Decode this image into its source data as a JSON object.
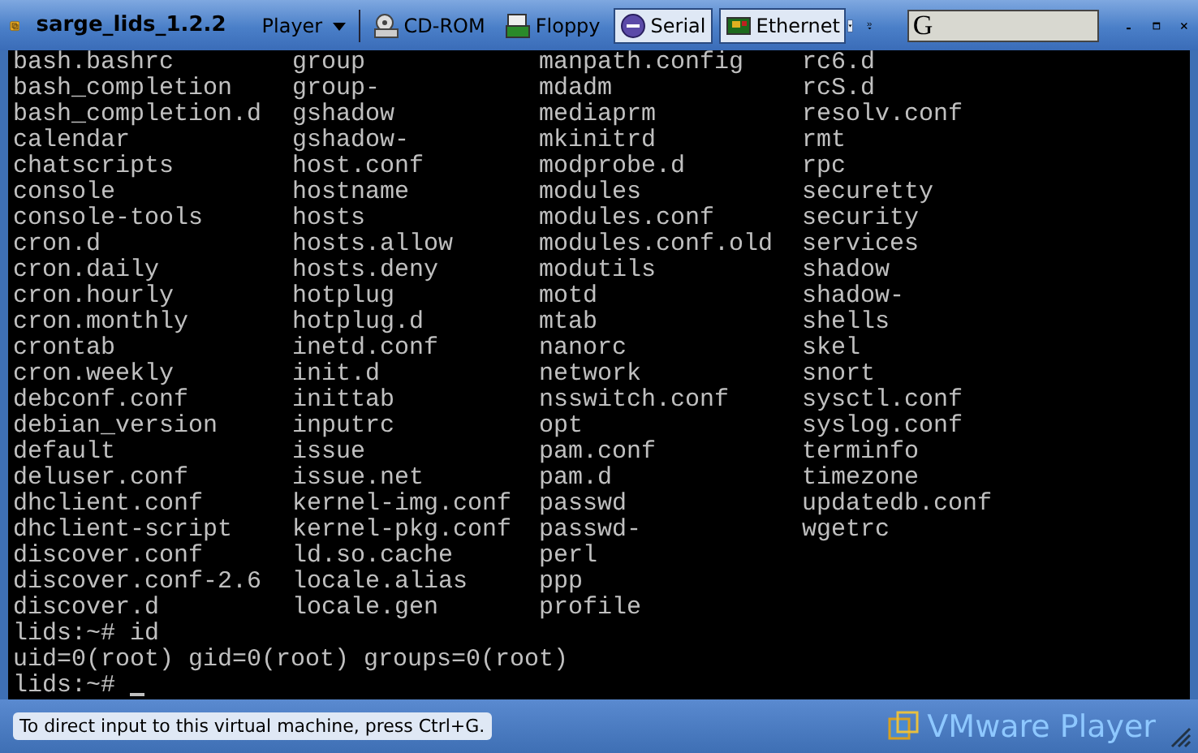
{
  "window": {
    "title": "sarge_lids_1.2.2"
  },
  "toolbar": [
    {
      "kind": "menu",
      "label": "Player"
    },
    {
      "kind": "device",
      "label": "CD-ROM",
      "selected": false
    },
    {
      "kind": "device",
      "label": "Floppy",
      "selected": false
    },
    {
      "kind": "device",
      "label": "Serial",
      "selected": true
    },
    {
      "kind": "device",
      "label": "Ethernet",
      "selected": true
    }
  ],
  "search": {
    "value": "G"
  },
  "terminal": {
    "columns": [
      [
        "bash.bashrc",
        "bash_completion",
        "bash_completion.d",
        "calendar",
        "chatscripts",
        "console",
        "console-tools",
        "cron.d",
        "cron.daily",
        "cron.hourly",
        "cron.monthly",
        "crontab",
        "cron.weekly",
        "debconf.conf",
        "debian_version",
        "default",
        "deluser.conf",
        "dhclient.conf",
        "dhclient-script",
        "discover.conf",
        "discover.conf-2.6",
        "discover.d"
      ],
      [
        "group",
        "group-",
        "gshadow",
        "gshadow-",
        "host.conf",
        "hostname",
        "hosts",
        "hosts.allow",
        "hosts.deny",
        "hotplug",
        "hotplug.d",
        "inetd.conf",
        "init.d",
        "inittab",
        "inputrc",
        "issue",
        "issue.net",
        "kernel-img.conf",
        "kernel-pkg.conf",
        "ld.so.cache",
        "locale.alias",
        "locale.gen"
      ],
      [
        "manpath.config",
        "mdadm",
        "mediaprm",
        "mkinitrd",
        "modprobe.d",
        "modules",
        "modules.conf",
        "modules.conf.old",
        "modutils",
        "motd",
        "mtab",
        "nanorc",
        "network",
        "nsswitch.conf",
        "opt",
        "pam.conf",
        "pam.d",
        "passwd",
        "passwd-",
        "perl",
        "ppp",
        "profile"
      ],
      [
        "rc6.d",
        "rcS.d",
        "resolv.conf",
        "rmt",
        "rpc",
        "securetty",
        "security",
        "services",
        "shadow",
        "shadow-",
        "shells",
        "skel",
        "snort",
        "sysctl.conf",
        "syslog.conf",
        "terminfo",
        "timezone",
        "updatedb.conf",
        "wgetrc"
      ]
    ],
    "lines": [
      "lids:~# id",
      "uid=0(root) gid=0(root) groups=0(root)",
      "lids:~#"
    ]
  },
  "status_bar": {
    "message": "To direct input to this virtual machine, press Ctrl+G.",
    "brand": "VMware Player"
  }
}
